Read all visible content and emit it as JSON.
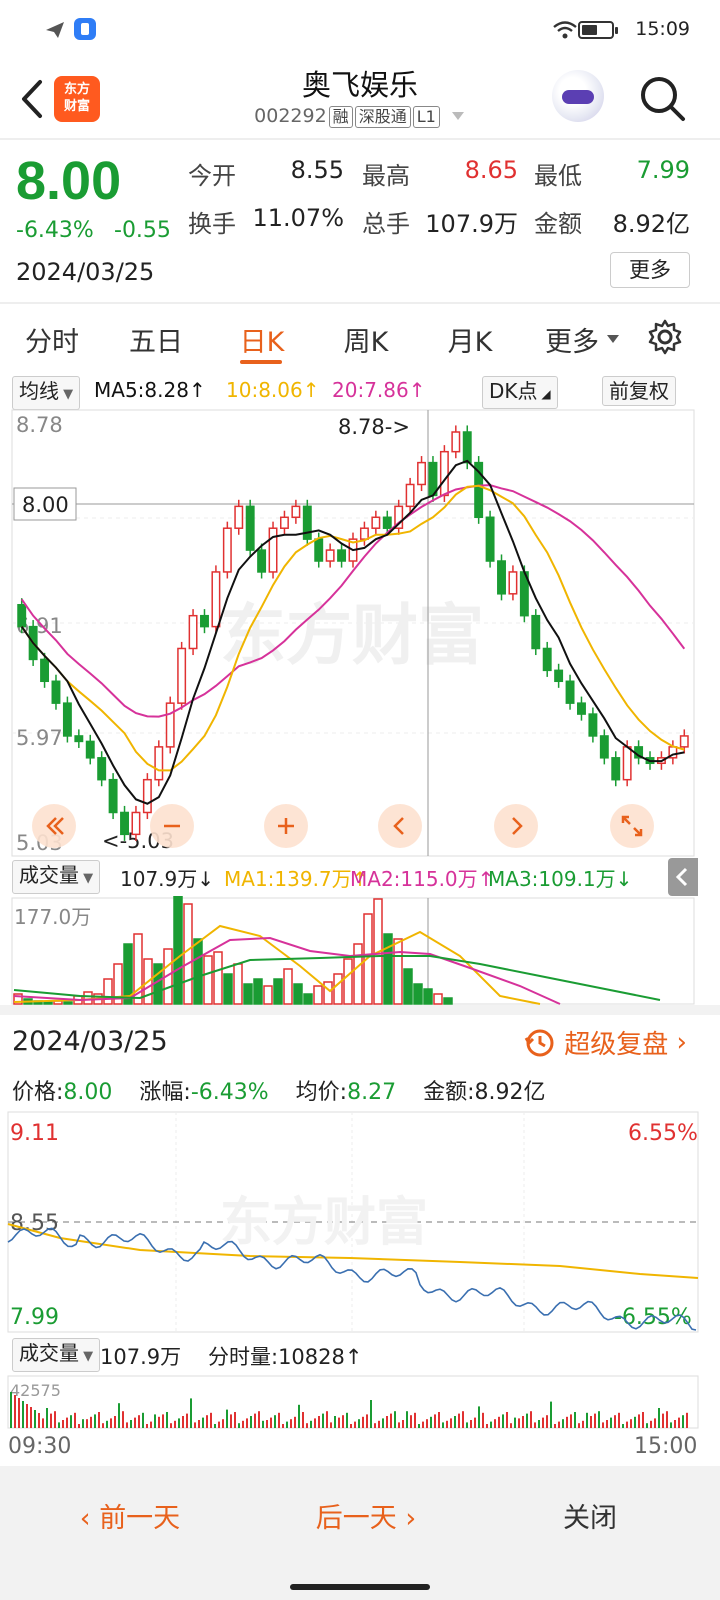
{
  "status_bar": {
    "time": "15:09",
    "battery_level": 0.55
  },
  "header": {
    "logo_text": [
      "东方",
      "财富"
    ],
    "title": "奥飞娱乐",
    "code": "002292",
    "tags": [
      "融",
      "深股通",
      "L1"
    ]
  },
  "quote": {
    "price": "8.00",
    "change_pct": "-6.43%",
    "change": "-0.55",
    "date": "2024/03/25",
    "fields": [
      {
        "label": "今开",
        "value": "8.55",
        "color": "#222"
      },
      {
        "label": "最高",
        "value": "8.65",
        "color": "#e03131"
      },
      {
        "label": "最低",
        "value": "7.99",
        "color": "#1a9c33"
      },
      {
        "label": "换手",
        "value": "11.07%",
        "color": "#222"
      },
      {
        "label": "总手",
        "value": "107.9万",
        "color": "#222"
      },
      {
        "label": "金额",
        "value": "8.92亿",
        "color": "#222"
      }
    ],
    "more_label": "更多"
  },
  "tabs": [
    "分时",
    "五日",
    "日K",
    "周K",
    "月K",
    "更多"
  ],
  "active_tab": "日K",
  "kline_bar": {
    "ma_select": "均线",
    "ma5": "MA5:8.28",
    "ma10": "10:8.06",
    "ma20": "20:7.86",
    "dk_label": "DK点",
    "adjust_label": "前复权"
  },
  "kline": {
    "y_labels": [
      "8.78",
      "8.00",
      "6.91",
      "5.97",
      "5.03"
    ],
    "high_annotation": "8.78->",
    "low_annotation": "<-5.03",
    "crosshair_price": "8.00",
    "watermark": "东方财富",
    "colors": {
      "up": "#e03131",
      "down": "#1a9c33",
      "ma5": "#111111",
      "ma10": "#f0b500",
      "ma20": "#d6329a"
    }
  },
  "vol_bar": {
    "select": "成交量",
    "vol": "107.9万",
    "ma1": "MA1:139.7万",
    "ma2": "MA2:115.0万",
    "ma3": "MA3:109.1万",
    "y_label": "177.0万"
  },
  "detail": {
    "date": "2024/03/25",
    "review_label": "超级复盘",
    "price_label": "价格:",
    "price": "8.00",
    "pct_label": "涨幅:",
    "pct": "-6.43%",
    "avg_label": "均价:",
    "avg": "8.27",
    "amount_label": "金额:",
    "amount": "8.92亿"
  },
  "intraday": {
    "high": "9.11",
    "high_pct": "6.55%",
    "mid": "8.55",
    "low": "7.99",
    "low_pct": "-6.55%",
    "watermark": "东方财富"
  },
  "intraday_vol": {
    "select": "成交量",
    "vol": "107.9万",
    "tick_vol": "分时量:10828",
    "y_label": "42575",
    "start_time": "09:30",
    "end_time": "15:00"
  },
  "bottom": {
    "prev": "前一天",
    "next": "后一天",
    "close": "关闭"
  }
}
